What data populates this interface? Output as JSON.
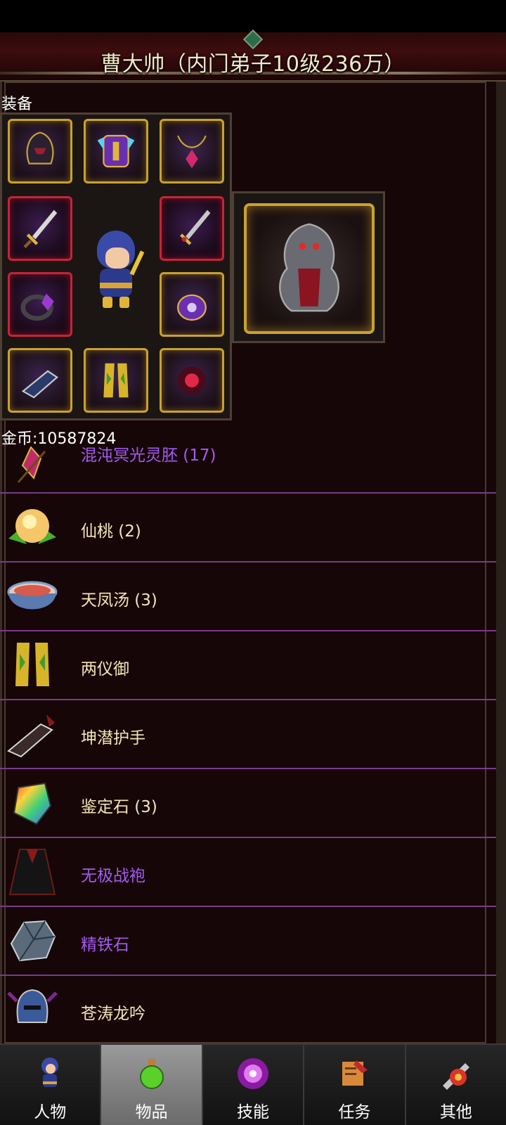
{
  "header": {
    "title": "曹大帅（内门弟子10级236万）"
  },
  "equipment": {
    "section_label": "装备"
  },
  "gold": {
    "label": "金币:10587824"
  },
  "items": [
    {
      "name": "混沌冥光灵胚 (17)",
      "color": "#a35bf0",
      "icon": "gem-icon"
    },
    {
      "name": "仙桃 (2)",
      "color": "#f2e6b6",
      "icon": "peach-icon"
    },
    {
      "name": "天凤汤 (3)",
      "color": "#f2e6b6",
      "icon": "soup-bowl-icon"
    },
    {
      "name": "两仪御",
      "color": "#f2e6b6",
      "icon": "flame-leggings-icon"
    },
    {
      "name": "坤潜护手",
      "color": "#f2e6b6",
      "icon": "gauntlet-icon"
    },
    {
      "name": "鉴定石 (3)",
      "color": "#f2e6b6",
      "icon": "rainbow-stone-icon"
    },
    {
      "name": "无极战袍",
      "color": "#a35bf0",
      "icon": "robe-icon"
    },
    {
      "name": "精铁石",
      "color": "#a35bf0",
      "icon": "iron-ore-icon"
    },
    {
      "name": "苍涛龙吟",
      "color": "#f2e6b6",
      "icon": "helmet-icon"
    }
  ],
  "tabs": [
    {
      "label": "人物",
      "icon": "character-icon",
      "active": false
    },
    {
      "label": "物品",
      "icon": "potion-icon",
      "active": true
    },
    {
      "label": "技能",
      "icon": "skill-orb-icon",
      "active": false
    },
    {
      "label": "任务",
      "icon": "quest-scroll-icon",
      "active": false
    },
    {
      "label": "其他",
      "icon": "misc-icon",
      "active": false
    }
  ]
}
